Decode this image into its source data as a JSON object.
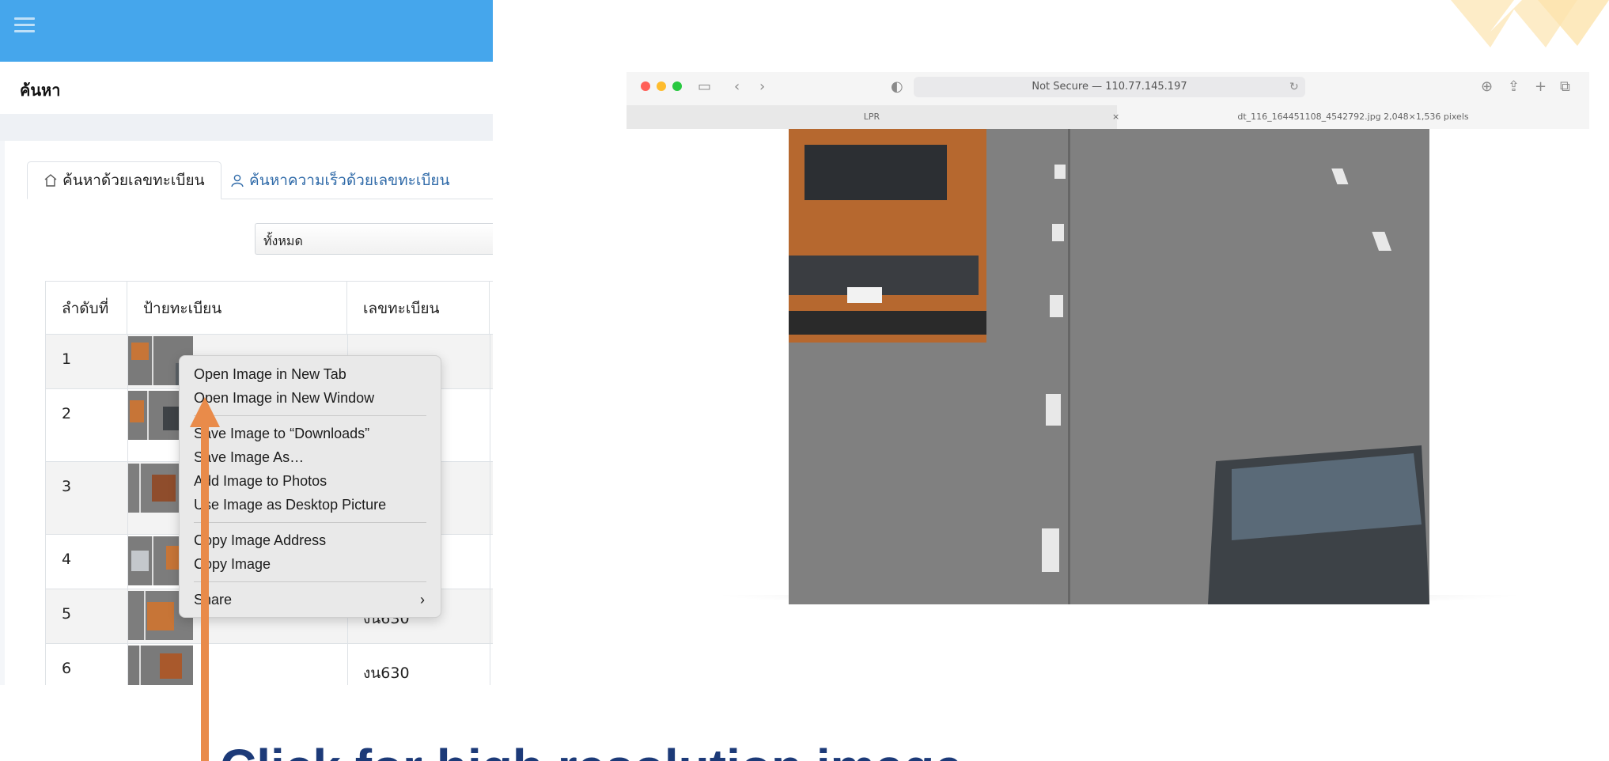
{
  "app": {
    "section_title": "ค้นหา",
    "tabs": [
      {
        "label": "ค้นหาด้วยเลขทะเบียน",
        "icon": "home-icon"
      },
      {
        "label": "ค้นหาความเร็วด้วยเลขทะเบียน",
        "icon": "user-icon"
      }
    ],
    "filter": {
      "selected": "ทั้งหมด"
    },
    "table": {
      "headers": [
        "ลำดับที่",
        "ป้ายทะเบียน",
        "เลขทะเบียน"
      ],
      "rows": [
        {
          "idx": "1",
          "plate": ""
        },
        {
          "idx": "2",
          "plate": ""
        },
        {
          "idx": "3",
          "plate": ""
        },
        {
          "idx": "4",
          "plate": ""
        },
        {
          "idx": "5",
          "plate": "งน630"
        },
        {
          "idx": "6",
          "plate": "งน630"
        }
      ]
    }
  },
  "context_menu": {
    "group1": [
      "Open Image in New Tab",
      "Open Image in New Window"
    ],
    "group2": [
      "Save Image to “Downloads”",
      "Save Image As…",
      "Add Image to Photos",
      "Use Image as Desktop Picture"
    ],
    "group3": [
      "Copy Image Address",
      "Copy Image"
    ],
    "share": "Share",
    "share_chevron": "›"
  },
  "caption": "Click for high resolution image",
  "browser": {
    "url": "Not Secure — 110.77.145.197",
    "tab1": "LPR",
    "tab2": "dt_116_164451108_4542792.jpg 2,048×1,536 pixels",
    "tab_close": "×",
    "traffic_colors": [
      "#ff5f57",
      "#febc2e",
      "#28c840"
    ]
  },
  "colors": {
    "app_bar": "#45a6ec",
    "arrow": "#e98b4a",
    "caption": "#1c3a78",
    "tab_link": "#2f6aa8"
  }
}
